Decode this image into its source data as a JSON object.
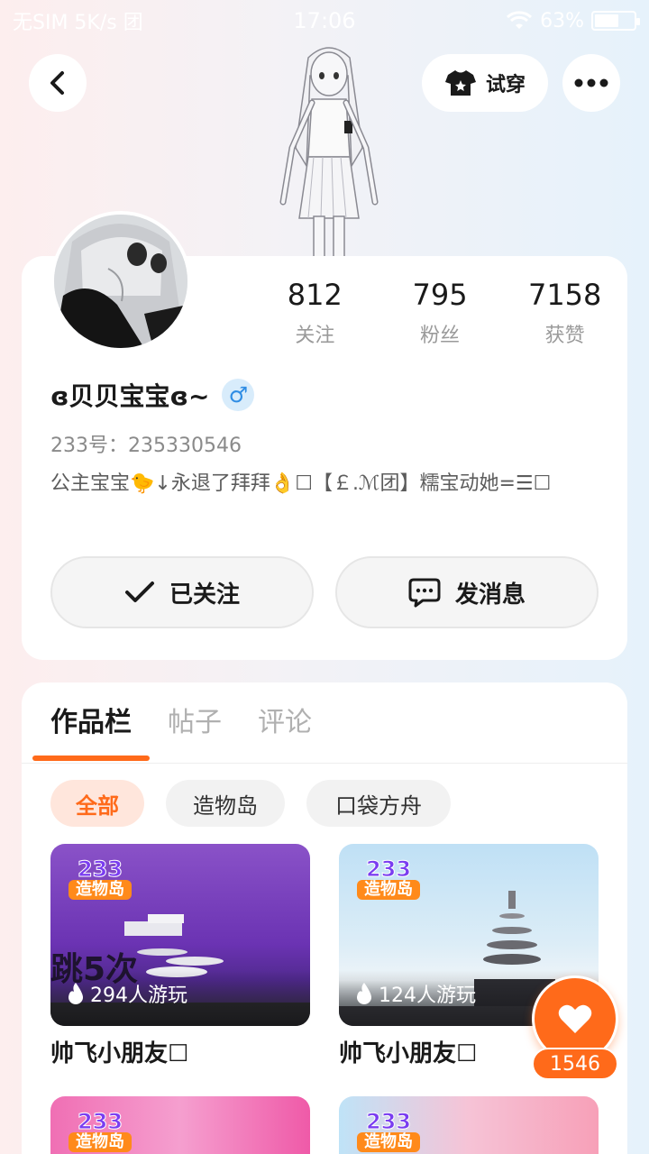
{
  "status_bar": {
    "left": "无SIM 5K/s 团",
    "time": "17:06",
    "battery": "63%",
    "battery_level": 0.63
  },
  "header": {
    "try_on_label": "试穿"
  },
  "profile": {
    "stats": [
      {
        "value": "812",
        "label": "关注"
      },
      {
        "value": "795",
        "label": "粉丝"
      },
      {
        "value": "7158",
        "label": "获赞"
      }
    ],
    "name": "ɞ贝贝宝宝ɞ~",
    "gender_symbol": "♂",
    "uid": "233号：235330546",
    "bio": "公主宝宝🐤↓永退了拜拜👌☐【￡.ℳ团】糯宝动她=☰☐",
    "follow_label": "已关注",
    "message_label": "发消息"
  },
  "tabs": [
    "作品栏",
    "帖子",
    "评论"
  ],
  "filters": [
    "全部",
    "造物岛",
    "口袋方舟"
  ],
  "games": [
    {
      "badge_top": "233",
      "badge_bottom": "造物岛",
      "overlay_text": "跳5次",
      "players": "294人游玩",
      "title": "帅飞小朋友☐"
    },
    {
      "badge_top": "233",
      "badge_bottom": "造物岛",
      "overlay_text": "",
      "players": "124人游玩",
      "title": "帅飞小朋友☐"
    },
    {
      "badge_top": "233",
      "badge_bottom": "造物岛",
      "overlay_text": "",
      "players": "",
      "title": ""
    },
    {
      "badge_top": "233",
      "badge_bottom": "造物岛",
      "overlay_text": "",
      "players": "",
      "title": ""
    }
  ],
  "like": {
    "count": "1546"
  },
  "colors": {
    "accent": "#ff6a1a",
    "gender_blue": "#2f8de4"
  },
  "icons": [
    "back-icon",
    "tshirt-icon",
    "more-icon",
    "check-icon",
    "chat-icon",
    "fire-icon",
    "heart-icon",
    "wifi-icon",
    "battery-icon"
  ]
}
